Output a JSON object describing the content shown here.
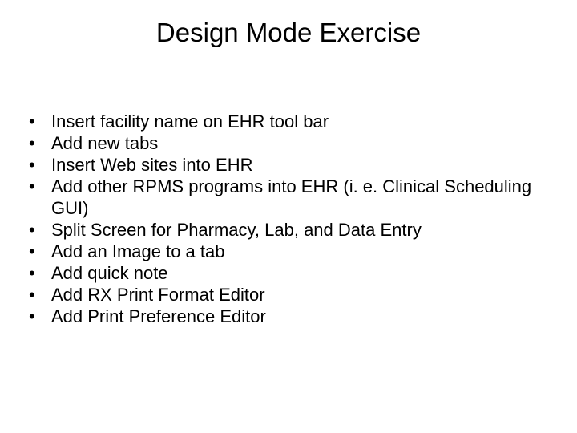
{
  "slide": {
    "title": "Design Mode Exercise",
    "bullets": [
      "Insert facility name on EHR tool bar",
      "Add new tabs",
      "Insert Web sites into EHR",
      "Add other RPMS programs into EHR (i. e. Clinical Scheduling GUI)",
      "Split Screen for Pharmacy, Lab, and Data Entry",
      "Add an Image to a tab",
      "Add quick note",
      "Add RX Print Format Editor",
      "Add Print Preference Editor"
    ]
  }
}
